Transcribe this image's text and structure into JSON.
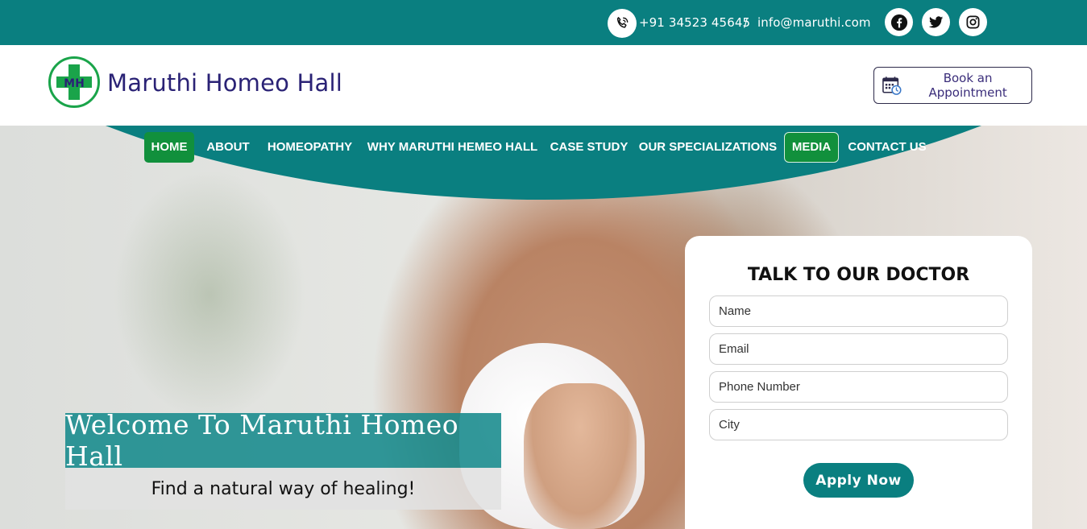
{
  "topbar": {
    "phone": "+91 34523 45645",
    "separator": "/",
    "email": "info@maruthi.com",
    "icons": [
      "phone-icon",
      "facebook-icon",
      "twitter-icon",
      "instagram-icon"
    ]
  },
  "header": {
    "logo_initials": "MH",
    "brand": "Maruthi Homeo Hall",
    "appointment_label": "Book an Appointment",
    "appointment_icon": "calendar-clock-icon"
  },
  "nav": {
    "items": [
      {
        "label": "HOME"
      },
      {
        "label": "ABOUT"
      },
      {
        "label": "HOMEOPATHY"
      },
      {
        "label": "WHY MARUTHI HEMEO HALL"
      },
      {
        "label": "CASE STUDY"
      },
      {
        "label": "OUR SPECIALIZATIONS"
      },
      {
        "label": "MEDIA"
      },
      {
        "label": "CONTACT US"
      }
    ]
  },
  "hero": {
    "welcome": "Welcome To Maruthi Homeo Hall",
    "tagline": "Find a natural way of healing!"
  },
  "form": {
    "title": "TALK TO OUR DOCTOR",
    "name_placeholder": "Name",
    "email_placeholder": "Email",
    "phone_placeholder": "Phone Number",
    "city_placeholder": "City",
    "submit_label": "Apply Now"
  },
  "colors": {
    "primary_teal": "#0a7f80",
    "accent_green": "#11903c",
    "brand_navy": "#2a2275"
  }
}
